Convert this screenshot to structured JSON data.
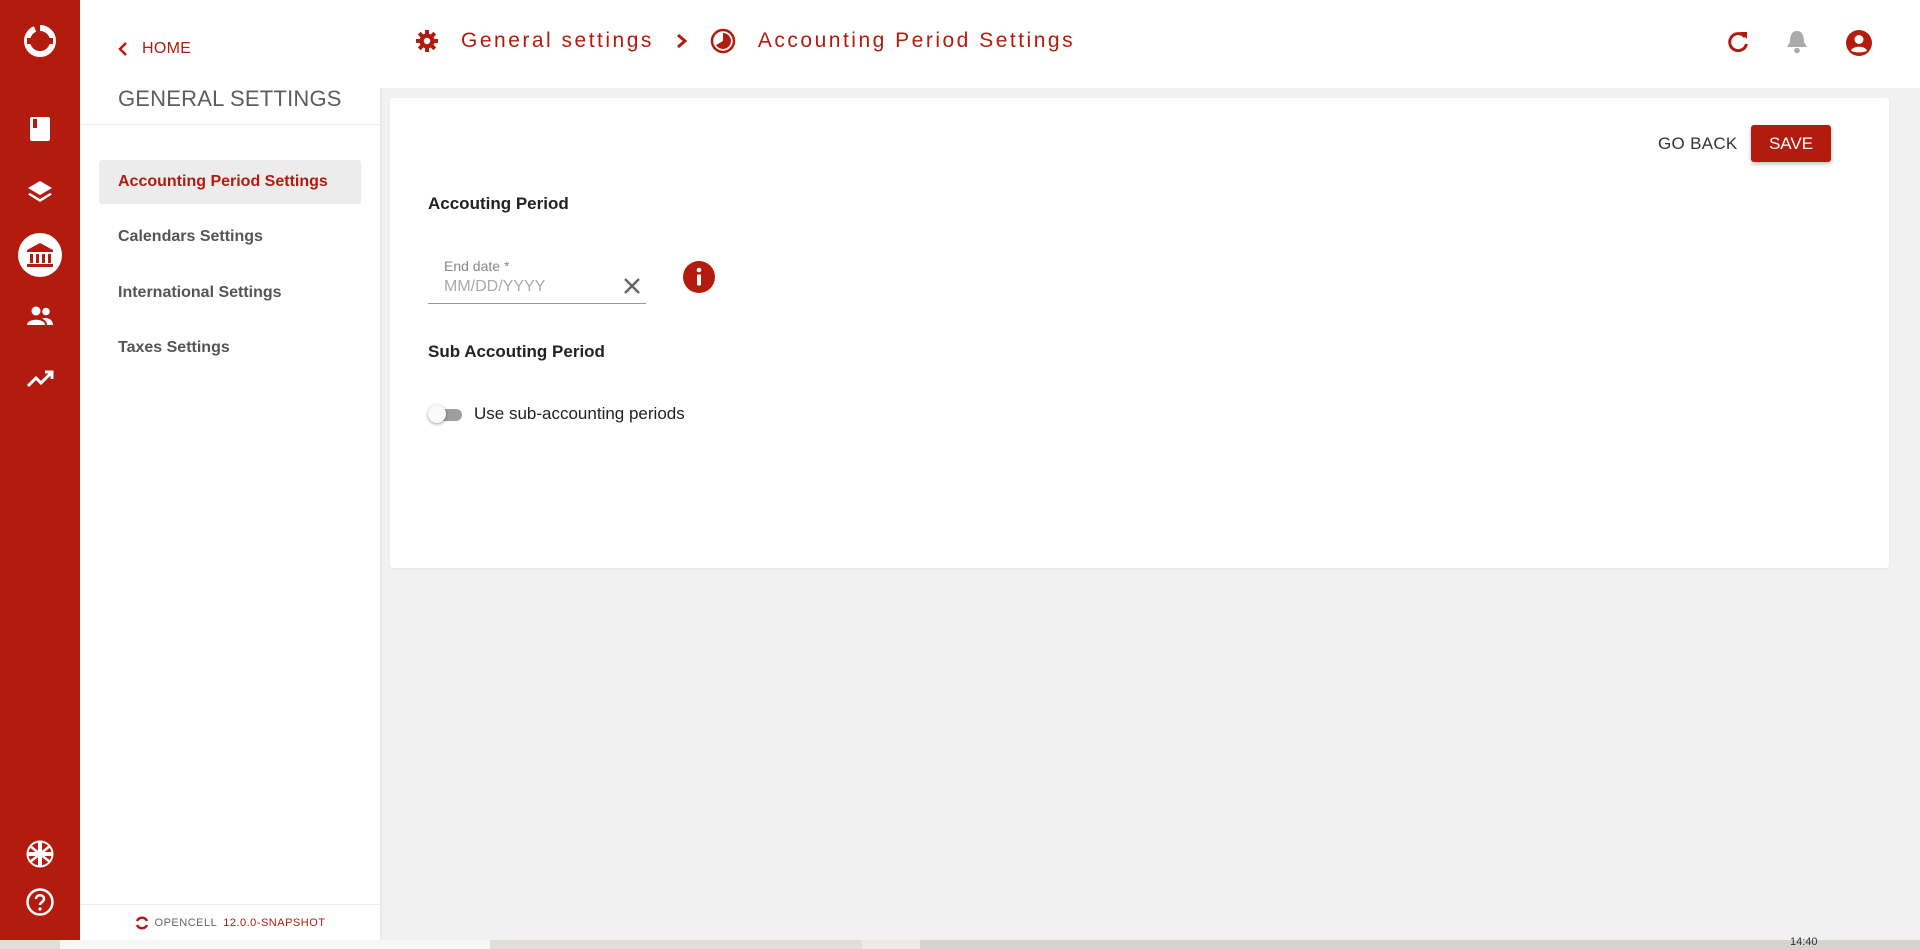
{
  "app": {
    "brand_name": "OPENCELL",
    "version": "12.0.0-SNAPSHOT",
    "accent_color": "#b31b0e"
  },
  "rail": {
    "icons": [
      "opencell-logo-icon",
      "book-icon",
      "layers-icon",
      "bank-icon",
      "people-icon",
      "trending-up-icon",
      "uk-flag-icon",
      "help-circle-icon"
    ],
    "active": "bank-icon"
  },
  "sidebar": {
    "home_label": "HOME",
    "section_title": "GENERAL SETTINGS",
    "items": [
      {
        "label": "Accounting Period Settings",
        "active": true
      },
      {
        "label": "Calendars Settings",
        "active": false
      },
      {
        "label": "International Settings",
        "active": false
      },
      {
        "label": "Taxes Settings",
        "active": false
      }
    ]
  },
  "header": {
    "breadcrumb": [
      {
        "label": "General settings",
        "icon": "gear-icon"
      },
      {
        "label": "Accounting Period Settings",
        "icon": "clock-half-icon"
      }
    ],
    "actions": [
      "refresh-icon",
      "bell-icon",
      "account-circle-icon"
    ]
  },
  "form": {
    "go_back_label": "GO BACK",
    "save_label": "SAVE",
    "section1_title": "Accouting Period",
    "end_date": {
      "label": "End date *",
      "placeholder": "MM/DD/YYYY",
      "value": ""
    },
    "section2_title": "Sub Accouting Period",
    "sub_periods_toggle": {
      "label": "Use sub-accounting periods",
      "checked": false
    }
  },
  "taskbar": {
    "clock": "14:40"
  }
}
